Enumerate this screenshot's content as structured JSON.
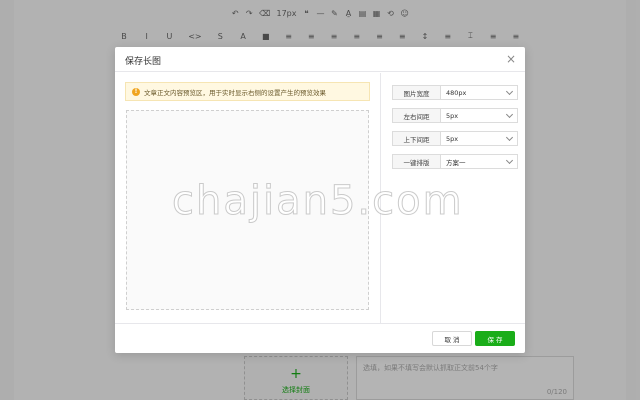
{
  "toolbar": {
    "row1": [
      "↶",
      "↷",
      "⌫",
      "17px",
      "❝",
      "—",
      "✎",
      "A̱",
      "▤",
      "▦",
      "⟲",
      "☺"
    ],
    "row2": [
      "B",
      "I",
      "U",
      "<>",
      "S",
      "A",
      "■",
      "≡",
      "≡",
      "≡",
      "≡",
      "≡",
      "≡",
      "↕",
      "≡",
      "⌶",
      "≡",
      "≡"
    ]
  },
  "cover": {
    "plus": "+",
    "label": "选择封面"
  },
  "abstract": {
    "placeholder": "选填，如果不填写会默认抓取正文前54个字",
    "count": "0/120"
  },
  "dialog": {
    "title": "保存长图",
    "close": "×",
    "tip": {
      "icon": "!",
      "text": "文章正文内容预览区，用于实时显示右侧的设置产生的预览效果"
    },
    "settings": [
      {
        "label": "图片宽度",
        "value": "480px"
      },
      {
        "label": "左右间距",
        "value": "5px"
      },
      {
        "label": "上下间距",
        "value": "5px"
      },
      {
        "label": "一键排版",
        "value": "方案一"
      }
    ],
    "cancel_label": "取 消",
    "save_label": "保 存"
  },
  "watermark": "chajian5.com",
  "colors": {
    "accent": "#1aad19",
    "tip_bg": "#fff8e1",
    "tip_icon": "#f0a520"
  }
}
